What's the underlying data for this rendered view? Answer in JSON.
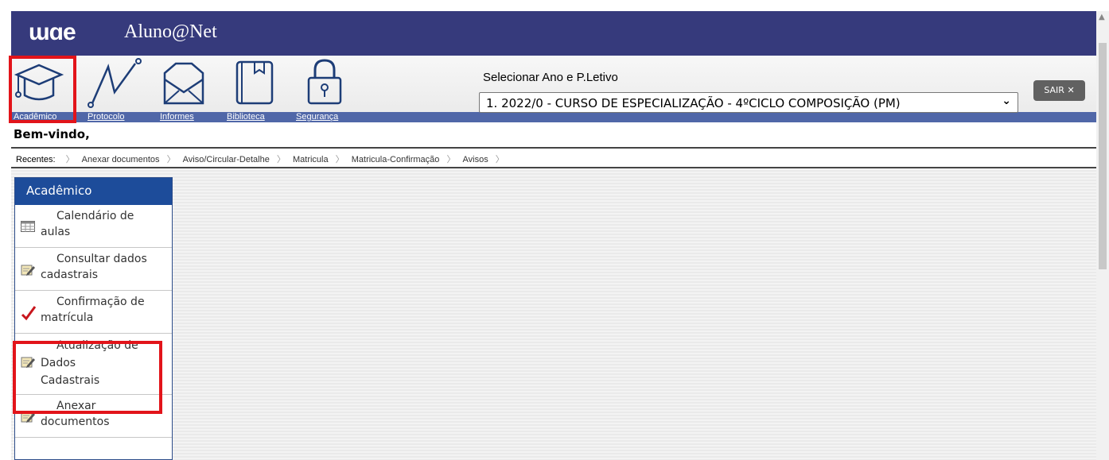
{
  "header": {
    "logo_text": "ɯɑe",
    "app_title": "Aluno@Net"
  },
  "nav": {
    "items": [
      {
        "label": "Acadêmico",
        "icon": "graduation-cap-icon"
      },
      {
        "label": "Protocolo",
        "icon": "line-chart-icon"
      },
      {
        "label": "Informes",
        "icon": "envelope-icon"
      },
      {
        "label": "Biblioteca",
        "icon": "book-icon"
      },
      {
        "label": "Segurança",
        "icon": "padlock-icon"
      }
    ]
  },
  "period": {
    "label": "Selecionar Ano e P.Letivo",
    "selected": "1. 2022/0 - CURSO DE ESPECIALIZAÇÃO - 4ºCICLO COMPOSIÇÃO (PM)"
  },
  "logout": {
    "label": "SAIR ✕"
  },
  "welcome": "Bem-vindo,",
  "recents": {
    "label": "Recentes:",
    "items": [
      "Anexar documentos",
      "Aviso/Circular-Detalhe",
      "Matricula",
      "Matricula-Confirmação",
      "Avisos"
    ]
  },
  "sidebar": {
    "title": "Acadêmico",
    "items": [
      {
        "line1": "Calendário de",
        "line2": "aulas",
        "icon": "calendar-grid-icon"
      },
      {
        "line1": "Consultar dados",
        "line2": "cadastrais",
        "icon": "edit-note-icon"
      },
      {
        "line1": "Confirmação de",
        "line2": "matrícula",
        "icon": "checkmark-icon"
      },
      {
        "line1": "Atualização de",
        "line2": "Dados",
        "line3": "Cadastrais",
        "icon": "edit-note-icon"
      },
      {
        "line1": "Anexar",
        "line2": "documentos",
        "icon": "edit-note-icon"
      }
    ]
  },
  "colors": {
    "header_bg": "#363a7c",
    "nav_bar": "#5067a8",
    "sidebar_header": "#1d4c9a",
    "highlight": "#e2141a"
  }
}
